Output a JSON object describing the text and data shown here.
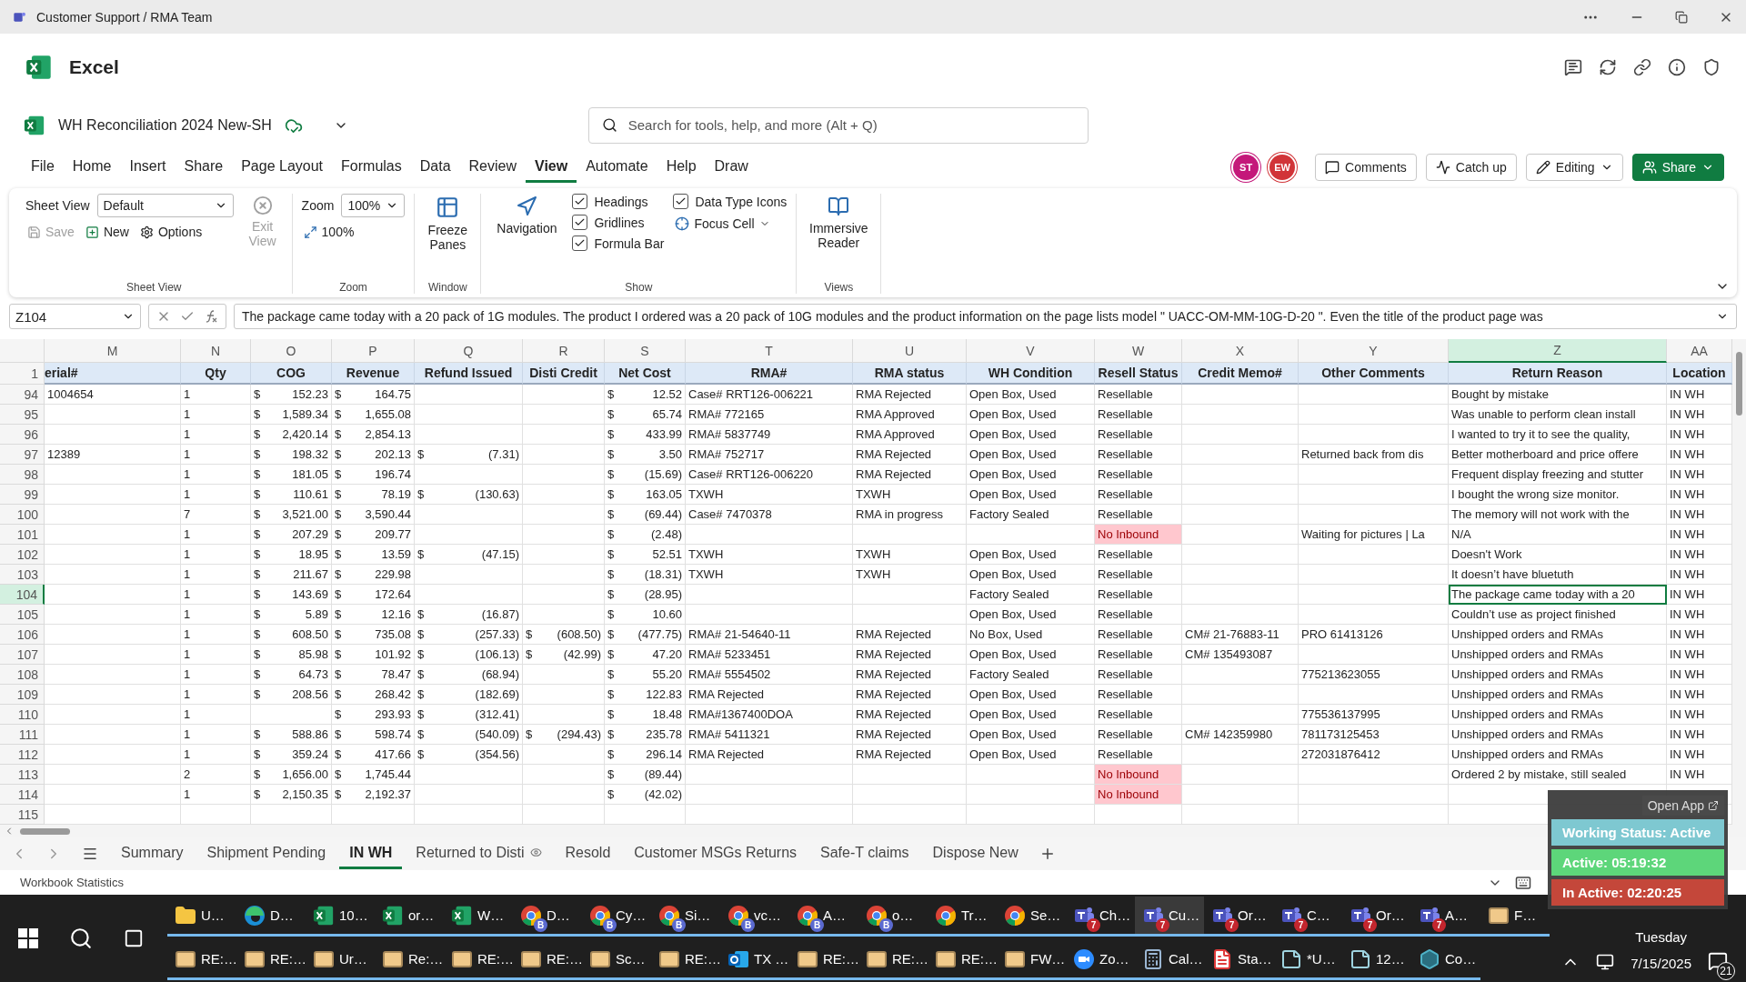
{
  "title_bar": {
    "title": "Customer Support / RMA Team"
  },
  "app": {
    "name": "Excel"
  },
  "document": {
    "name": "WH Reconciliation 2024 New-SH"
  },
  "search": {
    "placeholder": "Search for tools, help, and more (Alt + Q)"
  },
  "menu_tabs": [
    {
      "label": "File",
      "selected": false
    },
    {
      "label": "Home",
      "selected": false
    },
    {
      "label": "Insert",
      "selected": false
    },
    {
      "label": "Share",
      "selected": false
    },
    {
      "label": "Page Layout",
      "selected": false
    },
    {
      "label": "Formulas",
      "selected": false
    },
    {
      "label": "Data",
      "selected": false
    },
    {
      "label": "Review",
      "selected": false
    },
    {
      "label": "View",
      "selected": true
    },
    {
      "label": "Automate",
      "selected": false
    },
    {
      "label": "Help",
      "selected": false
    },
    {
      "label": "Draw",
      "selected": false
    }
  ],
  "collaborators": [
    {
      "initials": "ST",
      "color": "#c4187a"
    },
    {
      "initials": "EW",
      "color": "#d13438"
    }
  ],
  "header_buttons": [
    {
      "label": "Comments",
      "kind": "comments"
    },
    {
      "label": "Catch up",
      "kind": "catchup"
    },
    {
      "label": "Editing",
      "kind": "editing"
    },
    {
      "label": "Share",
      "kind": "share"
    }
  ],
  "ribbon": {
    "sheet_view": {
      "label": "Sheet View",
      "value": "Default",
      "group": "Sheet View",
      "exit": {
        "label": "Exit View",
        "disabled": true
      },
      "buttons": [
        {
          "label": "Save",
          "kind": "save",
          "disabled": true
        },
        {
          "label": "New",
          "kind": "new",
          "disabled": false
        },
        {
          "label": "Options",
          "kind": "options",
          "disabled": false
        }
      ]
    },
    "zoom": {
      "label": "Zoom",
      "value": "100%",
      "button": "100%",
      "group": "Zoom"
    },
    "window": {
      "button": "Freeze Panes",
      "group": "Window"
    },
    "show": {
      "navigation": "Navigation",
      "focus_cell": "Focus Cell",
      "group": "Show",
      "checks": [
        {
          "label": "Headings",
          "checked": true
        },
        {
          "label": "Gridlines",
          "checked": true
        },
        {
          "label": "Formula Bar",
          "checked": true
        },
        {
          "label": "Data Type Icons",
          "checked": true
        }
      ]
    },
    "views": {
      "button": "Immersive Reader",
      "group": "Views"
    }
  },
  "formula_bar": {
    "name_box": "Z104",
    "formula": "The package came today with a 20 pack of 1G modules.  The product I ordered was a 20 pack of 10G modules and the product information on the page lists model \" UACC-OM-MM-10G-D-20 \".  Even the title of the product page was"
  },
  "sheet": {
    "header_row": "1",
    "columns": [
      {
        "letter": "M",
        "heading": "erial#",
        "kind": "text",
        "selected": false
      },
      {
        "letter": "N",
        "heading": "Qty",
        "kind": "text",
        "selected": false
      },
      {
        "letter": "O",
        "heading": "COG",
        "kind": "money",
        "selected": false
      },
      {
        "letter": "P",
        "heading": "Revenue",
        "kind": "money",
        "selected": false
      },
      {
        "letter": "Q",
        "heading": "Refund Issued",
        "kind": "money",
        "selected": false
      },
      {
        "letter": "R",
        "heading": "Disti Credit",
        "kind": "money",
        "selected": false
      },
      {
        "letter": "S",
        "heading": "Net Cost",
        "kind": "money",
        "selected": false
      },
      {
        "letter": "T",
        "heading": "RMA#",
        "kind": "text",
        "selected": false
      },
      {
        "letter": "U",
        "heading": "RMA status",
        "kind": "text",
        "selected": false
      },
      {
        "letter": "V",
        "heading": "WH Condition",
        "kind": "text",
        "selected": false
      },
      {
        "letter": "W",
        "heading": "Resell Status",
        "kind": "text",
        "selected": false
      },
      {
        "letter": "X",
        "heading": "Credit Memo#",
        "kind": "text",
        "selected": false
      },
      {
        "letter": "Y",
        "heading": "Other Comments",
        "kind": "text",
        "selected": false
      },
      {
        "letter": "Z",
        "heading": "Return Reason",
        "kind": "text",
        "selected": true
      },
      {
        "letter": "AA",
        "heading": "Location",
        "kind": "text",
        "selected": false
      }
    ],
    "rows": [
      {
        "row": "94",
        "selected": false,
        "resell_alert": false,
        "cells": [
          "1004654",
          "1",
          [
            "$",
            "152.23"
          ],
          [
            "$",
            "164.75"
          ],
          null,
          null,
          [
            "$",
            "12.52"
          ],
          "Case# RRT126-006221",
          "RMA Rejected",
          "Open Box, Used",
          "Resellable",
          null,
          null,
          "Bought by mistake",
          "IN WH"
        ]
      },
      {
        "row": "95",
        "selected": false,
        "resell_alert": false,
        "cells": [
          null,
          "1",
          [
            "$",
            "1,589.34"
          ],
          [
            "$",
            "1,655.08"
          ],
          null,
          null,
          [
            "$",
            "65.74"
          ],
          "RMA# 772165",
          "RMA Approved",
          "Open Box, Used",
          "Resellable",
          null,
          null,
          "Was unable to perform clean install",
          "IN WH"
        ]
      },
      {
        "row": "96",
        "selected": false,
        "resell_alert": false,
        "cells": [
          null,
          "1",
          [
            "$",
            "2,420.14"
          ],
          [
            "$",
            "2,854.13"
          ],
          null,
          null,
          [
            "$",
            "433.99"
          ],
          "RMA# 5837749",
          "RMA Approved",
          "Open Box, Used",
          "Resellable",
          null,
          null,
          "I wanted to try it to see the quality,",
          "IN WH"
        ]
      },
      {
        "row": "97",
        "selected": false,
        "resell_alert": false,
        "cells": [
          "12389",
          "1",
          [
            "$",
            "198.32"
          ],
          [
            "$",
            "202.13"
          ],
          [
            "$",
            "(7.31)"
          ],
          null,
          [
            "$",
            "3.50"
          ],
          "RMA# 752717",
          "RMA Rejected",
          "Open Box, Used",
          "Resellable",
          null,
          "Returned back from dis",
          "Better motherboard and price offere",
          "IN WH"
        ]
      },
      {
        "row": "98",
        "selected": false,
        "resell_alert": false,
        "cells": [
          null,
          "1",
          [
            "$",
            "181.05"
          ],
          [
            "$",
            "196.74"
          ],
          null,
          null,
          [
            "$",
            "(15.69)"
          ],
          "Case# RRT126-006220",
          "RMA Rejected",
          "Open Box, Used",
          "Resellable",
          null,
          null,
          "Frequent display freezing and stutter",
          "IN WH"
        ]
      },
      {
        "row": "99",
        "selected": false,
        "resell_alert": false,
        "cells": [
          null,
          "1",
          [
            "$",
            "110.61"
          ],
          [
            "$",
            "78.19"
          ],
          [
            "$",
            "(130.63)"
          ],
          null,
          [
            "$",
            "163.05"
          ],
          "TXWH",
          "TXWH",
          "Open Box, Used",
          "Resellable",
          null,
          null,
          "I bought the wrong size monitor.",
          "IN WH"
        ]
      },
      {
        "row": "100",
        "selected": false,
        "resell_alert": false,
        "cells": [
          null,
          "7",
          [
            "$",
            "3,521.00"
          ],
          [
            "$",
            "3,590.44"
          ],
          null,
          null,
          [
            "$",
            "(69.44)"
          ],
          "Case# 7470378",
          "RMA in progress",
          "Factory Sealed",
          "Resellable",
          null,
          null,
          "The memory will not work with the",
          "IN WH"
        ]
      },
      {
        "row": "101",
        "selected": false,
        "resell_alert": true,
        "cells": [
          null,
          "1",
          [
            "$",
            "207.29"
          ],
          [
            "$",
            "209.77"
          ],
          null,
          null,
          [
            "$",
            "(2.48)"
          ],
          null,
          null,
          null,
          "No Inbound",
          null,
          "Waiting for pictures | La",
          "N/A",
          "IN WH"
        ]
      },
      {
        "row": "102",
        "selected": false,
        "resell_alert": false,
        "cells": [
          null,
          "1",
          [
            "$",
            "18.95"
          ],
          [
            "$",
            "13.59"
          ],
          [
            "$",
            "(47.15)"
          ],
          null,
          [
            "$",
            "52.51"
          ],
          "TXWH",
          "TXWH",
          "Open Box, Used",
          "Resellable",
          null,
          null,
          "Doesn't Work",
          "IN WH"
        ]
      },
      {
        "row": "103",
        "selected": false,
        "resell_alert": false,
        "cells": [
          null,
          "1",
          [
            "$",
            "211.67"
          ],
          [
            "$",
            "229.98"
          ],
          null,
          null,
          [
            "$",
            "(18.31)"
          ],
          "TXWH",
          "TXWH",
          "Open Box, Used",
          "Resellable",
          null,
          null,
          "It doesn’t have bluetuth",
          "IN WH"
        ]
      },
      {
        "row": "104",
        "selected": true,
        "resell_alert": false,
        "cells": [
          null,
          "1",
          [
            "$",
            "143.69"
          ],
          [
            "$",
            "172.64"
          ],
          null,
          null,
          [
            "$",
            "(28.95)"
          ],
          null,
          null,
          "Factory Sealed",
          "Resellable",
          null,
          null,
          "The package came today with a 20",
          "IN WH"
        ]
      },
      {
        "row": "105",
        "selected": false,
        "resell_alert": false,
        "cells": [
          null,
          "1",
          [
            "$",
            "5.89"
          ],
          [
            "$",
            "12.16"
          ],
          [
            "$",
            "(16.87)"
          ],
          null,
          [
            "$",
            "10.60"
          ],
          null,
          null,
          "Open Box, Used",
          "Resellable",
          null,
          null,
          "Couldn’t use as project finished",
          "IN WH"
        ]
      },
      {
        "row": "106",
        "selected": false,
        "resell_alert": false,
        "cells": [
          null,
          "1",
          [
            "$",
            "608.50"
          ],
          [
            "$",
            "735.08"
          ],
          [
            "$",
            "(257.33)"
          ],
          [
            "$",
            "(608.50)"
          ],
          [
            "$",
            "(477.75)"
          ],
          "RMA# 21-54640-11",
          "RMA Rejected",
          "No Box, Used",
          "Resellable",
          "CM# 21-76883-11",
          "PRO 61413126",
          "Unshipped orders and RMAs",
          "IN WH"
        ]
      },
      {
        "row": "107",
        "selected": false,
        "resell_alert": false,
        "cells": [
          null,
          "1",
          [
            "$",
            "85.98"
          ],
          [
            "$",
            "101.92"
          ],
          [
            "$",
            "(106.13)"
          ],
          [
            "$",
            "(42.99)"
          ],
          [
            "$",
            "47.20"
          ],
          "RMA# 5233451",
          "RMA Rejected",
          "Open Box, Used",
          "Resellable",
          "CM# 135493087",
          null,
          "Unshipped orders and RMAs",
          "IN WH"
        ]
      },
      {
        "row": "108",
        "selected": false,
        "resell_alert": false,
        "cells": [
          null,
          "1",
          [
            "$",
            "64.73"
          ],
          [
            "$",
            "78.47"
          ],
          [
            "$",
            "(68.94)"
          ],
          null,
          [
            "$",
            "55.20"
          ],
          "RMA# 5554502",
          "RMA Rejected",
          "Factory Sealed",
          "Resellable",
          null,
          "775213623055",
          "Unshipped orders and RMAs",
          "IN WH"
        ]
      },
      {
        "row": "109",
        "selected": false,
        "resell_alert": false,
        "cells": [
          null,
          "1",
          [
            "$",
            "208.56"
          ],
          [
            "$",
            "268.42"
          ],
          [
            "$",
            "(182.69)"
          ],
          null,
          [
            "$",
            "122.83"
          ],
          "RMA Rejected",
          "RMA Rejected",
          "Open Box, Used",
          "Resellable",
          null,
          null,
          "Unshipped orders and RMAs",
          "IN WH"
        ]
      },
      {
        "row": "110",
        "selected": false,
        "resell_alert": false,
        "cells": [
          null,
          "1",
          null,
          [
            "$",
            "293.93"
          ],
          [
            "$",
            "(312.41)"
          ],
          null,
          [
            "$",
            "18.48"
          ],
          "RMA#1367400DOA",
          "RMA Rejected",
          "Open Box, Used",
          "Resellable",
          null,
          "775536137995",
          "Unshipped orders and RMAs",
          "IN WH"
        ]
      },
      {
        "row": "111",
        "selected": false,
        "resell_alert": false,
        "cells": [
          null,
          "1",
          [
            "$",
            "588.86"
          ],
          [
            "$",
            "598.74"
          ],
          [
            "$",
            "(540.09)"
          ],
          [
            "$",
            "(294.43)"
          ],
          [
            "$",
            "235.78"
          ],
          "RMA# 5411321",
          "RMA Rejected",
          "Open Box, Used",
          "Resellable",
          "CM# 142359980",
          "781173125453",
          "Unshipped orders and RMAs",
          "IN WH"
        ]
      },
      {
        "row": "112",
        "selected": false,
        "resell_alert": false,
        "cells": [
          null,
          "1",
          [
            "$",
            "359.24"
          ],
          [
            "$",
            "417.66"
          ],
          [
            "$",
            "(354.56)"
          ],
          null,
          [
            "$",
            "296.14"
          ],
          "RMA Rejected",
          "RMA Rejected",
          "Open Box, Used",
          "Resellable",
          null,
          "272031876412",
          "Unshipped orders and RMAs",
          "IN WH"
        ]
      },
      {
        "row": "113",
        "selected": false,
        "resell_alert": true,
        "cells": [
          null,
          "2",
          [
            "$",
            "1,656.00"
          ],
          [
            "$",
            "1,745.44"
          ],
          null,
          null,
          [
            "$",
            "(89.44)"
          ],
          null,
          null,
          null,
          "No Inbound",
          null,
          null,
          "Ordered 2 by mistake, still sealed",
          "IN WH"
        ]
      },
      {
        "row": "114",
        "selected": false,
        "resell_alert": true,
        "cells": [
          null,
          "1",
          [
            "$",
            "2,150.35"
          ],
          [
            "$",
            "2,192.37"
          ],
          null,
          null,
          [
            "$",
            "(42.02)"
          ],
          null,
          null,
          null,
          "No Inbound",
          null,
          null,
          null,
          null
        ]
      },
      {
        "row": "115",
        "selected": false,
        "resell_alert": false,
        "cells": [
          null,
          null,
          null,
          null,
          null,
          null,
          null,
          null,
          null,
          null,
          null,
          null,
          null,
          null,
          null
        ]
      }
    ]
  },
  "sheet_tabs": [
    {
      "label": "Summary",
      "selected": false,
      "watched": false
    },
    {
      "label": "Shipment Pending",
      "selected": false,
      "watched": false
    },
    {
      "label": "IN WH",
      "selected": true,
      "watched": false
    },
    {
      "label": "Returned to Disti",
      "selected": false,
      "watched": true
    },
    {
      "label": "Resold",
      "selected": false,
      "watched": false
    },
    {
      "label": "Customer MSGs Returns",
      "selected": false,
      "watched": false
    },
    {
      "label": "Safe-T claims",
      "selected": false,
      "watched": false
    },
    {
      "label": "Dispose New",
      "selected": false,
      "watched": false
    }
  ],
  "status_bar": {
    "text": "Workbook Statistics"
  },
  "overlay": {
    "button": "Open App",
    "status": [
      {
        "text": "Working Status: Active",
        "color": "#7ec8d1"
      },
      {
        "text": "Active: 05:19:32",
        "color": "#5dd67a"
      },
      {
        "text": "In Active: 02:20:25",
        "color": "#c4473a"
      }
    ]
  },
  "taskbar": {
    "rows": [
      [
        {
          "label": "U…",
          "kind": "folder",
          "active": false
        },
        {
          "label": "D…",
          "kind": "edge",
          "active": false
        },
        {
          "label": "10…",
          "kind": "excel",
          "active": false
        },
        {
          "label": "or…",
          "kind": "excel",
          "active": false
        },
        {
          "label": "W…",
          "kind": "excel",
          "active": false
        },
        {
          "label": "D…",
          "kind": "chrome",
          "badge": "B",
          "active": false
        },
        {
          "label": "Cy…",
          "kind": "chrome",
          "badge": "B",
          "active": false
        },
        {
          "label": "Si…",
          "kind": "chrome",
          "badge": "B",
          "active": false
        },
        {
          "label": "vc…",
          "kind": "chrome",
          "badge": "B",
          "active": false
        },
        {
          "label": "A…",
          "kind": "chrome",
          "badge": "B",
          "active": false
        },
        {
          "label": "o…",
          "kind": "chrome",
          "badge": "B",
          "active": false
        },
        {
          "label": "Tr…",
          "kind": "chrome",
          "active": false
        },
        {
          "label": "Se…",
          "kind": "chrome",
          "active": false
        },
        {
          "label": "Ch…",
          "kind": "teams",
          "badge": "7",
          "active": false
        },
        {
          "label": "Cu…",
          "kind": "teams",
          "badge": "7",
          "active": true
        },
        {
          "label": "Or…",
          "kind": "teams",
          "badge": "7",
          "active": false
        },
        {
          "label": "C…",
          "kind": "teams",
          "badge": "7",
          "active": false
        },
        {
          "label": "Or…",
          "kind": "teams",
          "badge": "7",
          "active": false
        },
        {
          "label": "A…",
          "kind": "teams",
          "badge": "7",
          "active": false
        },
        {
          "label": "F…",
          "kind": "mail",
          "active": false
        }
      ],
      [
        {
          "label": "RE:…",
          "kind": "mail",
          "active": false
        },
        {
          "label": "RE:…",
          "kind": "mail",
          "active": false
        },
        {
          "label": "Ur…",
          "kind": "mail",
          "active": false
        },
        {
          "label": "Re:…",
          "kind": "mail",
          "active": false
        },
        {
          "label": "RE:…",
          "kind": "mail",
          "active": false
        },
        {
          "label": "RE:…",
          "kind": "mail",
          "active": false
        },
        {
          "label": "Sc…",
          "kind": "mail",
          "active": false
        },
        {
          "label": "RE:…",
          "kind": "mail",
          "active": false
        },
        {
          "label": "TX …",
          "kind": "outlook",
          "active": false
        },
        {
          "label": "RE:…",
          "kind": "mail",
          "active": false
        },
        {
          "label": "RE:…",
          "kind": "mail",
          "active": false
        },
        {
          "label": "RE:…",
          "kind": "mail",
          "active": false
        },
        {
          "label": "FW…",
          "kind": "mail",
          "active": false
        },
        {
          "label": "Zo…",
          "kind": "zoom",
          "active": false
        },
        {
          "label": "Cal…",
          "kind": "calculator",
          "active": false
        },
        {
          "label": "Sta…",
          "kind": "pdf",
          "active": false
        },
        {
          "label": "*U…",
          "kind": "notepad",
          "active": false
        },
        {
          "label": "12…",
          "kind": "notepad",
          "active": false
        },
        {
          "label": "Co…",
          "kind": "app",
          "active": false
        }
      ]
    ],
    "tray": {
      "day": "Tuesday",
      "date": "7/15/2025",
      "notifications": "21"
    }
  }
}
